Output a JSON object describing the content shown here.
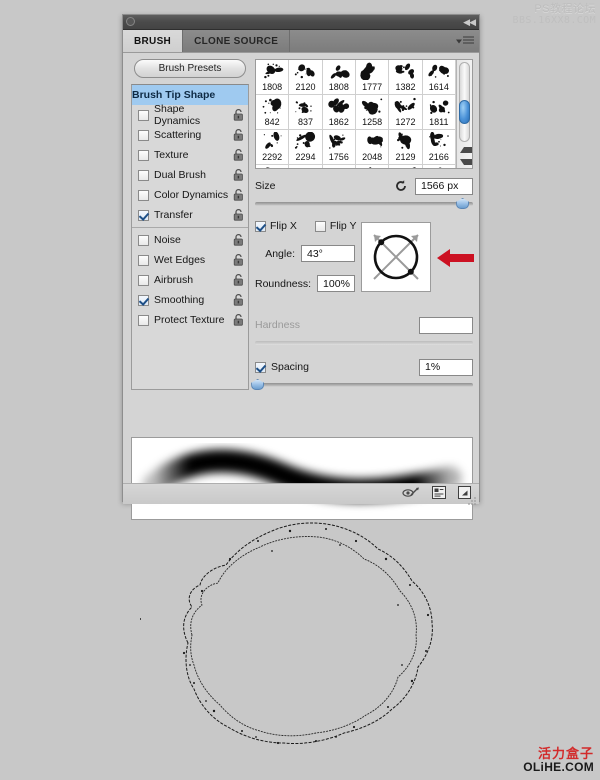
{
  "watermarks": {
    "top_cn": "PS教程论坛",
    "top_en": "BBS.16XX8.COM",
    "bottom_cn": "活力盒子",
    "bottom_en": "OLiHE.COM"
  },
  "panel": {
    "tabs": [
      {
        "label": "BRUSH",
        "active": true
      },
      {
        "label": "CLONE SOURCE",
        "active": false
      }
    ],
    "presets_button": "Brush Presets",
    "options": [
      {
        "label": "Brush Tip Shape",
        "type": "header",
        "selected": true
      },
      {
        "label": "Shape Dynamics",
        "checked": false,
        "locked": true
      },
      {
        "label": "Scattering",
        "checked": false,
        "locked": true
      },
      {
        "label": "Texture",
        "checked": false,
        "locked": true
      },
      {
        "label": "Dual Brush",
        "checked": false,
        "locked": true
      },
      {
        "label": "Color Dynamics",
        "checked": false,
        "locked": true
      },
      {
        "label": "Transfer",
        "checked": true,
        "locked": true
      },
      {
        "label": "Noise",
        "checked": false,
        "locked": true,
        "separator_before": true
      },
      {
        "label": "Wet Edges",
        "checked": false,
        "locked": true
      },
      {
        "label": "Airbrush",
        "checked": false,
        "locked": true
      },
      {
        "label": "Smoothing",
        "checked": true,
        "locked": true
      },
      {
        "label": "Protect Texture",
        "checked": false,
        "locked": true
      }
    ],
    "brush_tips": [
      {
        "size": "1808"
      },
      {
        "size": "2120"
      },
      {
        "size": "1808"
      },
      {
        "size": "1777"
      },
      {
        "size": "1382"
      },
      {
        "size": "1614"
      },
      {
        "size": "842"
      },
      {
        "size": "837"
      },
      {
        "size": "1862"
      },
      {
        "size": "1258"
      },
      {
        "size": "1272"
      },
      {
        "size": "1811"
      },
      {
        "size": "2292"
      },
      {
        "size": "2294"
      },
      {
        "size": "1756"
      },
      {
        "size": "2048"
      },
      {
        "size": "2129"
      },
      {
        "size": "2166"
      }
    ],
    "controls": {
      "size_label": "Size",
      "size_value": "1566 px",
      "size_slider_percent": 95,
      "flip_x_label": "Flip X",
      "flip_x_checked": true,
      "flip_y_label": "Flip Y",
      "flip_y_checked": false,
      "angle_label": "Angle:",
      "angle_value": "43°",
      "roundness_label": "Roundness:",
      "roundness_value": "100%",
      "hardness_label": "Hardness",
      "hardness_value": "",
      "hardness_enabled": false,
      "hardness_slider_percent": 0,
      "spacing_label": "Spacing",
      "spacing_checked": true,
      "spacing_value": "1%",
      "spacing_slider_percent": 1
    },
    "footer_icons": [
      "brush-preview-toggle-icon",
      "toggle-options-icon",
      "new-brush-icon"
    ]
  }
}
